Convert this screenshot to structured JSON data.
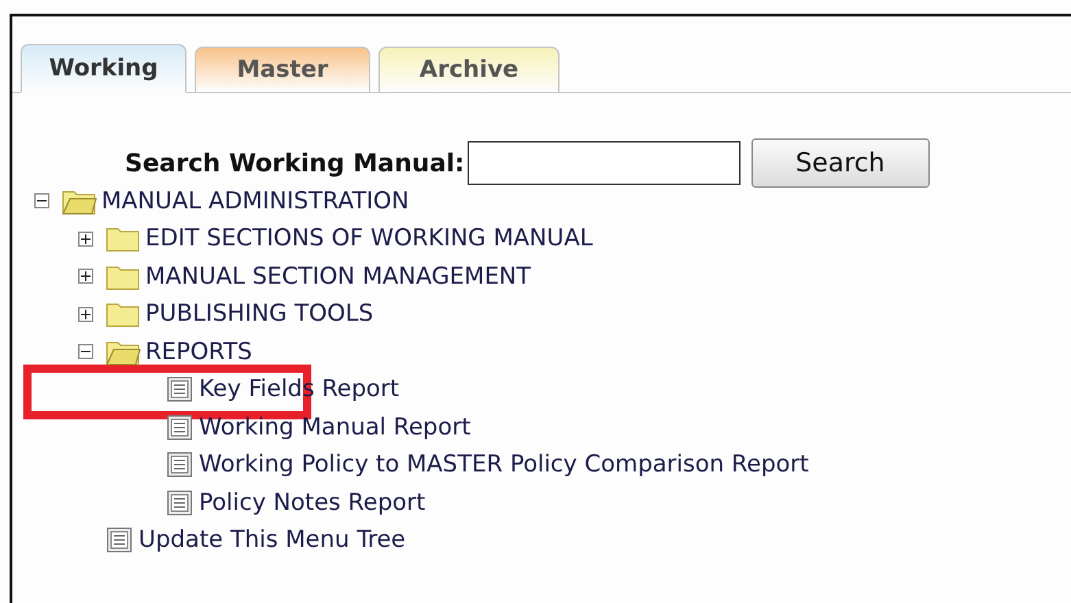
{
  "tabs": [
    {
      "label": "Working",
      "selected": true,
      "color": "#d6ebf7"
    },
    {
      "label": "Master",
      "selected": false,
      "color": "#f9c38a"
    },
    {
      "label": "Archive",
      "selected": false,
      "color": "#f7f2b8"
    }
  ],
  "search": {
    "label": "Search Working Manual:",
    "button": "Search"
  },
  "tree": [
    {
      "kind": "folder",
      "label": "MANUAL ADMINISTRATION",
      "expanded": true,
      "children": [
        {
          "kind": "folder",
          "label": "EDIT SECTIONS OF WORKING MANUAL",
          "expanded": false
        },
        {
          "kind": "folder",
          "label": "MANUAL SECTION MANAGEMENT",
          "expanded": false
        },
        {
          "kind": "folder",
          "label": "PUBLISHING TOOLS",
          "expanded": false
        },
        {
          "kind": "folder",
          "label": "REPORTS",
          "expanded": true,
          "children": [
            {
              "kind": "document",
              "label": "Key Fields Report"
            },
            {
              "kind": "document",
              "label": "Working Manual Report"
            },
            {
              "kind": "document",
              "label": "Working Policy to MASTER Policy Comparison Report"
            },
            {
              "kind": "document",
              "label": "Policy Notes Report"
            }
          ]
        },
        {
          "kind": "document",
          "label": "Update This Menu Tree"
        }
      ]
    }
  ]
}
